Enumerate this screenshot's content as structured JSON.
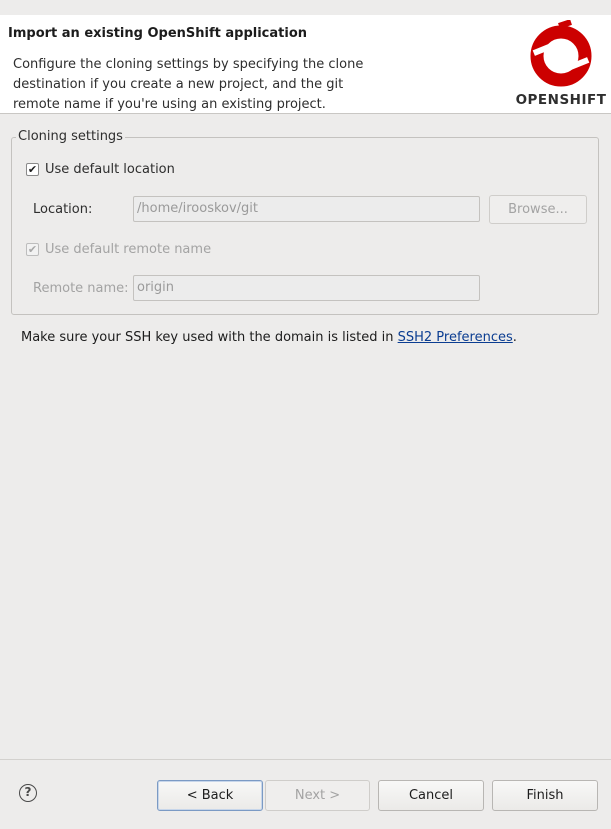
{
  "header": {
    "title": "Import an existing OpenShift application",
    "description": "Configure the cloning settings by specifying the clone destination if you create a new project, and the git remote name if you're using an existing project.",
    "logo_text": "OPENSHIFT"
  },
  "group": {
    "legend": "Cloning settings",
    "use_default_location": {
      "label": "Use default location",
      "checked": "✔"
    },
    "location": {
      "label": "Location:",
      "value": "/home/irooskov/git",
      "browse_label": "Browse..."
    },
    "use_default_remote": {
      "label": "Use default remote name",
      "checked": "✔"
    },
    "remote": {
      "label": "Remote name:",
      "value": "origin"
    }
  },
  "note": {
    "text": "Make sure your SSH key used with the domain is listed in ",
    "link": "SSH2 Preferences",
    "suffix": "."
  },
  "footer": {
    "help_icon": "?",
    "back_label": "< Back",
    "next_label": "Next >",
    "cancel_label": "Cancel",
    "finish_label": "Finish"
  },
  "colors": {
    "logo_red": "#cc0000",
    "link": "#0b3d91"
  }
}
